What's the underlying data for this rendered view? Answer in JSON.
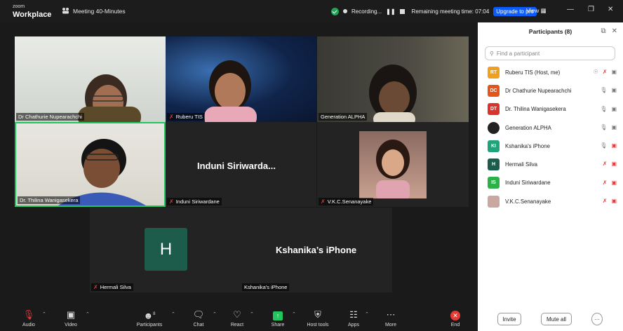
{
  "app": {
    "logo_line1": "zoom",
    "logo_line2": "Workplace",
    "meeting_title": "Meeting 40-Minutes",
    "recording_label": "Recording...",
    "remaining_time": "Remaining meeting time: 07:04",
    "upgrade_label": "Upgrade to pro",
    "view_label": "View"
  },
  "tiles": {
    "chathurie": "Dr Chathurie Nupearachchi",
    "ruberu": "Ruberu TIS",
    "alpha": "Generation ALPHA",
    "thilina": "Dr. Thilina Wanigasekera",
    "induni_big": "Induni Siriwarda...",
    "induni": "Induni Siriwardane",
    "vkc": "V.K.C.Senanayake",
    "hermali_initial": "H",
    "hermali": "Hermali Silva",
    "kshanika_big": "Kshanika’s iPhone",
    "kshanika": "Kshanika's iPhone"
  },
  "panel": {
    "title": "Participants (8)",
    "search_placeholder": "Find a participant",
    "participants": [
      {
        "initials": "RT",
        "name": "Ruberu TIS (Host, me)",
        "color": "#f0a020"
      },
      {
        "initials": "DC",
        "name": "Dr Chathurie Nupearachchi",
        "color": "#e2561d"
      },
      {
        "initials": "DT",
        "name": "Dr. Thilina Wanigasekera",
        "color": "#d9342b"
      },
      {
        "initials": "",
        "name": "Generation ALPHA",
        "color": "#222222"
      },
      {
        "initials": "KI",
        "name": "Kshanika's iPhone",
        "color": "#1fa37a"
      },
      {
        "initials": "H",
        "name": "Hermali Silva",
        "color": "#1d5c4a"
      },
      {
        "initials": "IS",
        "name": "Induni Siriwardane",
        "color": "#2cb14a"
      },
      {
        "initials": "",
        "name": "V.K.C.Senanayake",
        "color": "#c9a8a0"
      }
    ],
    "invite_label": "Invite",
    "mute_all_label": "Mute all",
    "more_label": "···"
  },
  "toolbar": {
    "audio": "Audio",
    "video": "Video",
    "participants": "Participants",
    "participants_count": "8",
    "chat": "Chat",
    "react": "React",
    "share": "Share",
    "host_tools": "Host tools",
    "apps": "Apps",
    "more": "More",
    "end": "End"
  }
}
